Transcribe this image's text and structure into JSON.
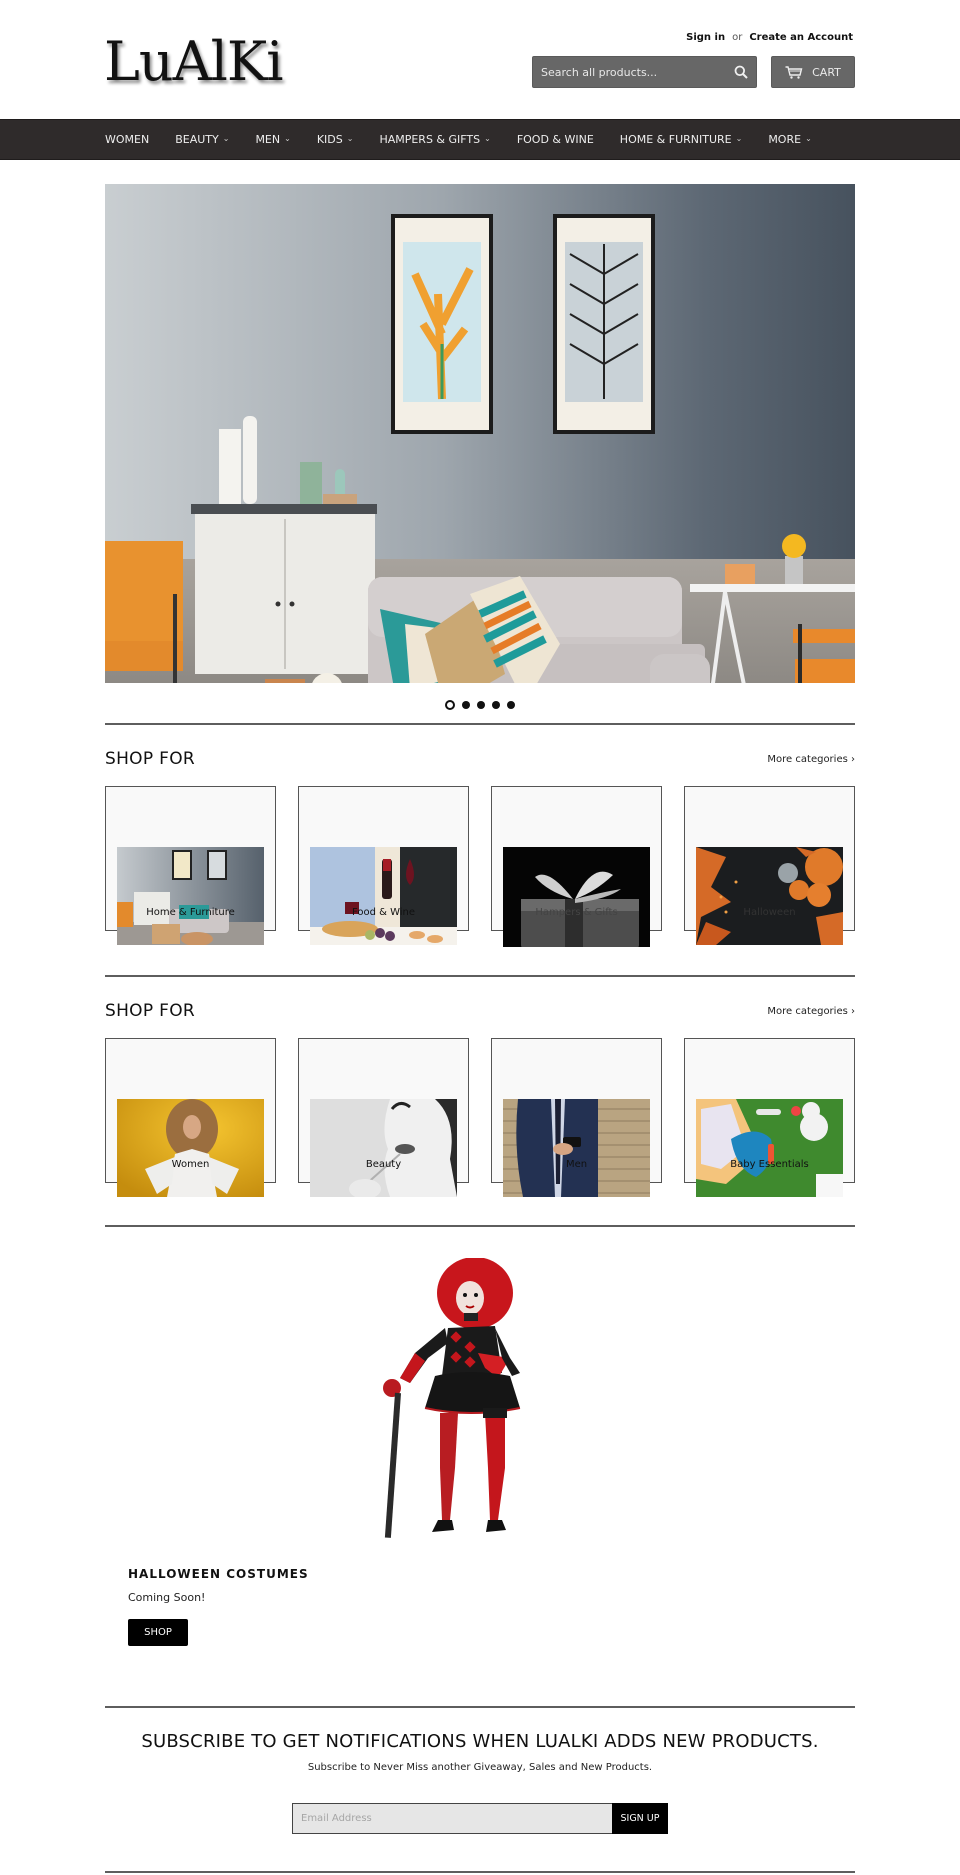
{
  "header": {
    "logo_text": "LuAlKi",
    "sign_in": "Sign in",
    "or": "or",
    "create_account": "Create an Account",
    "search_placeholder": "Search all products...",
    "cart_label": "CART"
  },
  "nav": {
    "items": [
      {
        "label": "WOMEN",
        "has_dropdown": false
      },
      {
        "label": "BEAUTY",
        "has_dropdown": true
      },
      {
        "label": "MEN",
        "has_dropdown": true
      },
      {
        "label": "KIDS",
        "has_dropdown": true
      },
      {
        "label": "HAMPERS & GIFTS",
        "has_dropdown": true
      },
      {
        "label": "FOOD & WINE",
        "has_dropdown": false
      },
      {
        "label": "HOME & FURNITURE",
        "has_dropdown": true
      },
      {
        "label": "MORE",
        "has_dropdown": true
      }
    ],
    "chevron": "⌄"
  },
  "hero": {
    "image_description": "Living room with grey sofa, patterned cushions, wicker side table, orange chairs and framed leaf prints",
    "slide_count": 5,
    "active_slide": 1
  },
  "shop_sections": [
    {
      "title": "SHOP FOR",
      "more_link": "More categories ›",
      "categories": [
        {
          "label": "Home & Furniture",
          "image": "living-room"
        },
        {
          "label": "Food & Wine",
          "image": "wine-dinner"
        },
        {
          "label": "Hampers & Gifts",
          "image": "gift-box"
        },
        {
          "label": "Halloween",
          "image": "pumpkins-leaves"
        }
      ]
    },
    {
      "title": "SHOP FOR",
      "more_link": "More categories ›",
      "categories": [
        {
          "label": "Women",
          "image": "woman-yellow"
        },
        {
          "label": "Beauty",
          "image": "lipstick-bw"
        },
        {
          "label": "Men",
          "image": "man-suit-brick"
        },
        {
          "label": "Baby Essentials",
          "image": "baby-toys-grass"
        }
      ]
    }
  ],
  "feature": {
    "image_description": "Woman in red and black harlequin jester costume with red wig and cane",
    "title": "HALLOWEEN COSTUMES",
    "subtitle": "Coming Soon!",
    "button": "SHOP"
  },
  "subscribe": {
    "title": "SUBSCRIBE TO GET NOTIFICATIONS WHEN LUALKI ADDS NEW PRODUCTS.",
    "text": "Subscribe to Never Miss another Giveaway, Sales and New Products.",
    "email_placeholder": "Email Address",
    "button": "SIGN UP"
  },
  "colors": {
    "nav_bg": "#2f2b2b",
    "header_control_bg": "#676767",
    "button_black": "#000000",
    "divider": "#5e5e5e"
  }
}
